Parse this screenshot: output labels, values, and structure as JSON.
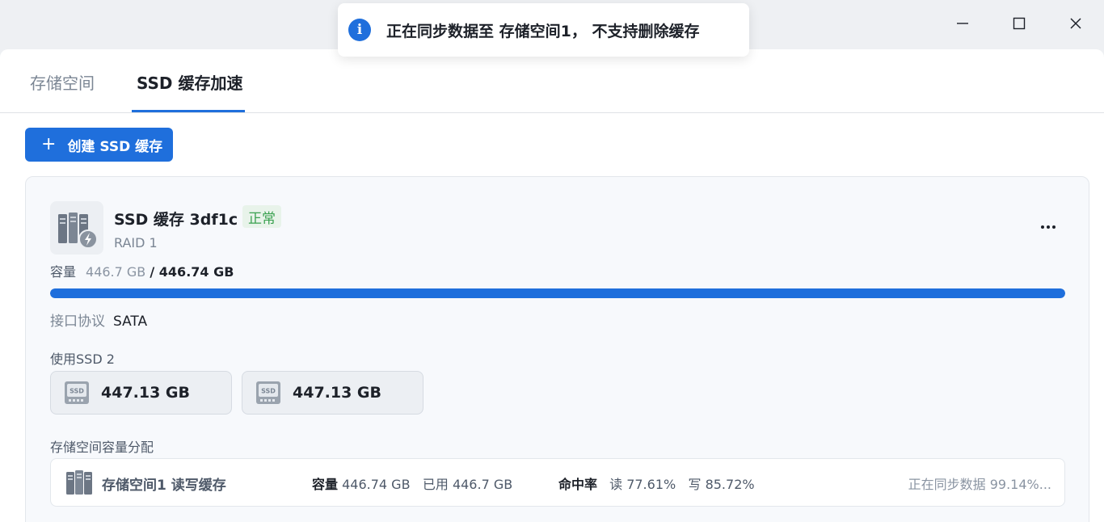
{
  "toast": {
    "icon": "info-icon",
    "message": "正在同步数据至 存储空间1， 不支持删除缓存"
  },
  "window": {
    "controls": [
      "minimize-icon",
      "maximize-icon",
      "close-icon"
    ]
  },
  "tabs": [
    {
      "label": "存储空间",
      "active": false
    },
    {
      "label": "SSD 缓存加速",
      "active": true
    }
  ],
  "toolbar": {
    "create_label": "创建 SSD 缓存",
    "create_icon": "plus-icon"
  },
  "cache": {
    "name": "SSD 缓存 3df1c",
    "status": "正常",
    "raid": "RAID 1",
    "capacity_label": "容量",
    "capacity_used": "446.7 GB",
    "capacity_total": "/ 446.74 GB",
    "capacity_fraction": 0.9999,
    "interface_label": "接口协议",
    "interface_value": "SATA",
    "used_ssd_label": "使用SSD 2",
    "disks": [
      {
        "size": "447.13 GB"
      },
      {
        "size": "447.13 GB"
      }
    ],
    "allocation_title": "存储空间容量分配",
    "allocation": {
      "name": "存储空间1  读写缓存",
      "capacity_label": "容量",
      "capacity_value": "446.74 GB",
      "used_label": "已用",
      "used_value": "446.7 GB",
      "hit_label": "命中率",
      "read": "读 77.61%",
      "write": "写 85.72%",
      "sync": "正在同步数据 99.14%..."
    }
  },
  "colors": {
    "accent": "#1f6fdc",
    "status_ok": "#3aa150"
  }
}
